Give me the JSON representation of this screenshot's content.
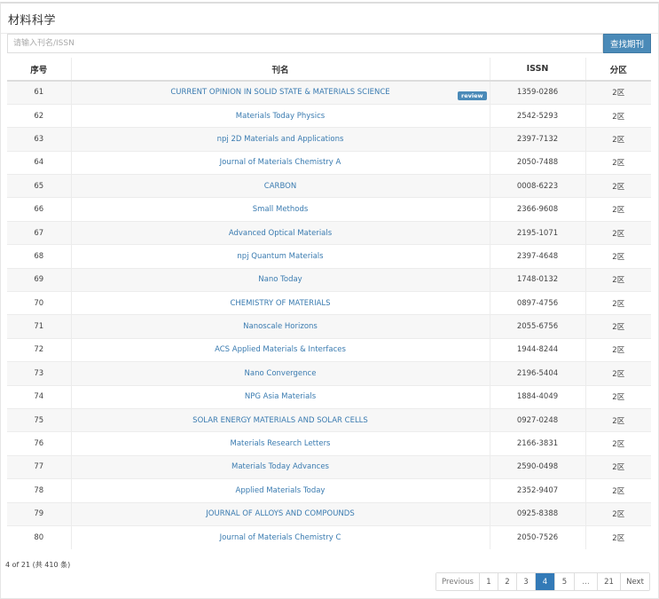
{
  "title": "材料科学",
  "search": {
    "placeholder": "请输入刊名/ISSN",
    "button": "查找期刊"
  },
  "columns": {
    "index": "序号",
    "name": "刊名",
    "issn": "ISSN",
    "zone": "分区"
  },
  "rows": [
    {
      "index": "61",
      "name": "CURRENT OPINION IN SOLID STATE & MATERIALS SCIENCE",
      "issn": "1359-0286",
      "zone": "2区",
      "badge": "review"
    },
    {
      "index": "62",
      "name": "Materials Today Physics",
      "issn": "2542-5293",
      "zone": "2区"
    },
    {
      "index": "63",
      "name": "npj 2D Materials and Applications",
      "issn": "2397-7132",
      "zone": "2区"
    },
    {
      "index": "64",
      "name": "Journal of Materials Chemistry A",
      "issn": "2050-7488",
      "zone": "2区"
    },
    {
      "index": "65",
      "name": "CARBON",
      "issn": "0008-6223",
      "zone": "2区"
    },
    {
      "index": "66",
      "name": "Small Methods",
      "issn": "2366-9608",
      "zone": "2区"
    },
    {
      "index": "67",
      "name": "Advanced Optical Materials",
      "issn": "2195-1071",
      "zone": "2区"
    },
    {
      "index": "68",
      "name": "npj Quantum Materials",
      "issn": "2397-4648",
      "zone": "2区"
    },
    {
      "index": "69",
      "name": "Nano Today",
      "issn": "1748-0132",
      "zone": "2区"
    },
    {
      "index": "70",
      "name": "CHEMISTRY OF MATERIALS",
      "issn": "0897-4756",
      "zone": "2区"
    },
    {
      "index": "71",
      "name": "Nanoscale Horizons",
      "issn": "2055-6756",
      "zone": "2区"
    },
    {
      "index": "72",
      "name": "ACS Applied Materials & Interfaces",
      "issn": "1944-8244",
      "zone": "2区"
    },
    {
      "index": "73",
      "name": "Nano Convergence",
      "issn": "2196-5404",
      "zone": "2区"
    },
    {
      "index": "74",
      "name": "NPG Asia Materials",
      "issn": "1884-4049",
      "zone": "2区"
    },
    {
      "index": "75",
      "name": "SOLAR ENERGY MATERIALS AND SOLAR CELLS",
      "issn": "0927-0248",
      "zone": "2区"
    },
    {
      "index": "76",
      "name": "Materials Research Letters",
      "issn": "2166-3831",
      "zone": "2区"
    },
    {
      "index": "77",
      "name": "Materials Today Advances",
      "issn": "2590-0498",
      "zone": "2区"
    },
    {
      "index": "78",
      "name": "Applied Materials Today",
      "issn": "2352-9407",
      "zone": "2区"
    },
    {
      "index": "79",
      "name": "JOURNAL OF ALLOYS AND COMPOUNDS",
      "issn": "0925-8388",
      "zone": "2区"
    },
    {
      "index": "80",
      "name": "Journal of Materials Chemistry C",
      "issn": "2050-7526",
      "zone": "2区"
    }
  ],
  "summary": "4 of 21 (共 410 条)",
  "pagination": {
    "previous": "Previous",
    "pages": [
      "1",
      "2",
      "3",
      "4",
      "5",
      "…",
      "21"
    ],
    "current": "4",
    "next": "Next"
  },
  "colors": {
    "accent": "#4a8ab8",
    "link": "#3a7bb0",
    "active_page": "#337ab7"
  }
}
